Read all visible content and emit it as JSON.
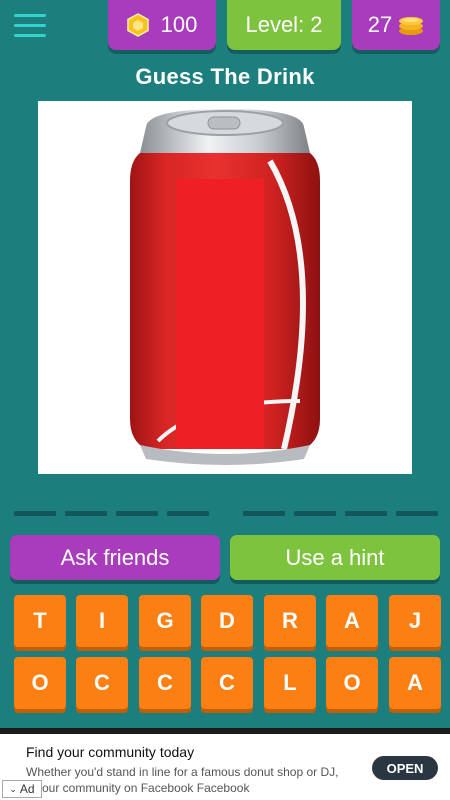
{
  "header": {
    "gems": "100",
    "level": "Level: 2",
    "coins": "27"
  },
  "title": "Guess The Drink",
  "answer_slots": 8,
  "buttons": {
    "ask": "Ask friends",
    "hint": "Use a hint"
  },
  "letters": [
    "T",
    "I",
    "G",
    "D",
    "R",
    "A",
    "J",
    "O",
    "C",
    "C",
    "C",
    "L",
    "O",
    "A"
  ],
  "ad": {
    "title": "Find your community today",
    "text_line1": "Whether you'd stand in line for a famous donut shop or DJ,",
    "text_line2": "d your community on Facebook Facebook",
    "badge": "Ad",
    "cta": "OPEN"
  },
  "colors": {
    "background": "#1d7e7e",
    "purple": "#a93bbd",
    "green": "#7dc33e",
    "tile": "#fb7f12",
    "can_red": "#d72624"
  }
}
